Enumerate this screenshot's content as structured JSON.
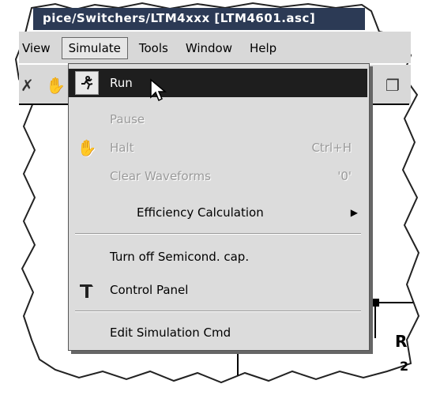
{
  "window": {
    "title": "pice/Switchers/LTM4xxx [LTM4601.asc]"
  },
  "menubar": {
    "items": [
      {
        "label": "View"
      },
      {
        "label": "Simulate"
      },
      {
        "label": "Tools"
      },
      {
        "label": "Window"
      },
      {
        "label": "Help"
      }
    ]
  },
  "simulate_menu": {
    "items": [
      {
        "label": "Run",
        "shortcut": "",
        "icon": "running-man-icon",
        "state": "highlighted"
      },
      {
        "label": "Pause",
        "shortcut": "",
        "icon": "",
        "state": "disabled"
      },
      {
        "label": "Halt",
        "shortcut": "Ctrl+H",
        "icon": "hand-icon",
        "state": "disabled"
      },
      {
        "label": "Clear Waveforms",
        "shortcut": "'0'",
        "icon": "",
        "state": "disabled"
      },
      {
        "label": "Efficiency Calculation",
        "shortcut": "",
        "icon": "",
        "state": "submenu"
      },
      {
        "label": "Turn off Semicond. cap.",
        "shortcut": "",
        "icon": "",
        "state": "enabled"
      },
      {
        "label": "Control Panel",
        "shortcut": "",
        "icon": "hammer-icon",
        "state": "enabled"
      },
      {
        "label": "Edit Simulation Cmd",
        "shortcut": "",
        "icon": "",
        "state": "enabled"
      }
    ]
  },
  "schematic": {
    "visible_text": [
      "R",
      "2"
    ]
  },
  "colors": {
    "highlight": "#1e1e1e",
    "menu_bg": "#dcdcdc",
    "disabled_text": "#9a9a9a"
  }
}
